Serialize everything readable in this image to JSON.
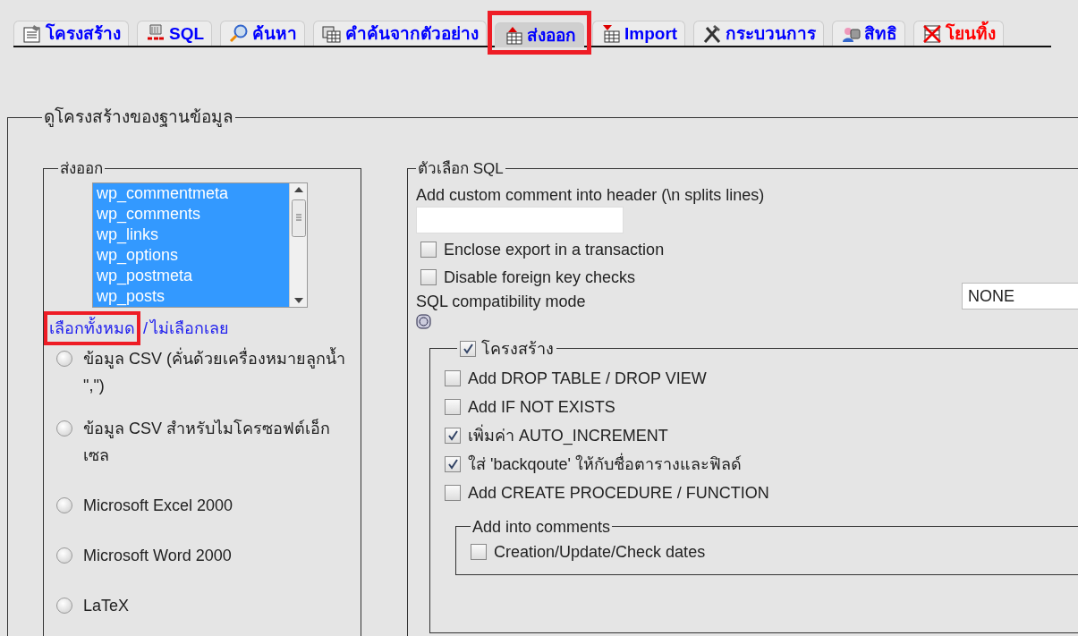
{
  "tabs": [
    {
      "label": "โครงสร้าง",
      "kind": "structure",
      "color": "#0000ff",
      "selected": false,
      "highlighted": false
    },
    {
      "label": "SQL",
      "kind": "sql",
      "color": "#0000ff",
      "selected": false,
      "highlighted": false
    },
    {
      "label": "ค้นหา",
      "kind": "search",
      "color": "#0000ff",
      "selected": false,
      "highlighted": false
    },
    {
      "label": "คำค้นจากตัวอย่าง",
      "kind": "query",
      "color": "#0000ff",
      "selected": false,
      "highlighted": false
    },
    {
      "label": "ส่งออก",
      "kind": "export",
      "color": "#0000ff",
      "selected": true,
      "highlighted": true
    },
    {
      "label": "Import",
      "kind": "import",
      "color": "#0000ff",
      "selected": false,
      "highlighted": false
    },
    {
      "label": "กระบวนการ",
      "kind": "tools",
      "color": "#0000ff",
      "selected": false,
      "highlighted": false
    },
    {
      "label": "สิทธิ",
      "kind": "privileges",
      "color": "#0000ff",
      "selected": false,
      "highlighted": false
    },
    {
      "label": "โยนทิ้ง",
      "kind": "drop",
      "color": "#ff0000",
      "selected": false,
      "highlighted": false
    }
  ],
  "view_dump": {
    "legend": "ดูโครงสร้างของฐานข้อมูล"
  },
  "export": {
    "legend": "ส่งออก",
    "tables": [
      {
        "label": "wp_commentmeta",
        "selected": true
      },
      {
        "label": "wp_comments",
        "selected": true
      },
      {
        "label": "wp_links",
        "selected": true
      },
      {
        "label": "wp_options",
        "selected": true
      },
      {
        "label": "wp_postmeta",
        "selected": true
      },
      {
        "label": "wp_posts",
        "selected": true
      }
    ],
    "select_all": {
      "label": "เลือกทั้งหมด",
      "highlighted": true
    },
    "separator": "/",
    "select_none": "ไม่เลือกเลย",
    "formats": [
      {
        "label": "ข้อมูล CSV (คั่นด้วยเครื่องหมายลูกน้ำ \",\")",
        "selected": false
      },
      {
        "label": "ข้อมูล CSV สำหรับไมโครซอฟต์เอ็กเซล",
        "selected": false
      },
      {
        "label": "Microsoft Excel 2000",
        "selected": false
      },
      {
        "label": "Microsoft Word 2000",
        "selected": false
      },
      {
        "label": "LaTeX",
        "selected": false
      }
    ]
  },
  "sql_options": {
    "legend": "ตัวเลือก SQL",
    "comment_label": "Add custom comment into header (\\n splits lines)",
    "options": [
      {
        "label": "Enclose export in a transaction",
        "checked": false
      },
      {
        "label": "Disable foreign key checks",
        "checked": false
      }
    ],
    "compat_label": "SQL compatibility mode",
    "compat_value": "NONE",
    "structure": {
      "legend": "โครงสร้าง",
      "checked": true,
      "options": [
        {
          "label": "Add DROP TABLE / DROP VIEW",
          "checked": false
        },
        {
          "label": "Add IF NOT EXISTS",
          "checked": false
        },
        {
          "label": "เพิ่มค่า AUTO_INCREMENT",
          "checked": true
        },
        {
          "label": "ใส่ 'backqoute' ให้กับชื่อตารางและฟิลด์",
          "checked": true
        },
        {
          "label": "Add CREATE PROCEDURE / FUNCTION",
          "checked": false
        }
      ],
      "comments": {
        "legend": "Add into comments",
        "options": [
          {
            "label": "Creation/Update/Check dates",
            "checked": false
          }
        ]
      }
    }
  }
}
